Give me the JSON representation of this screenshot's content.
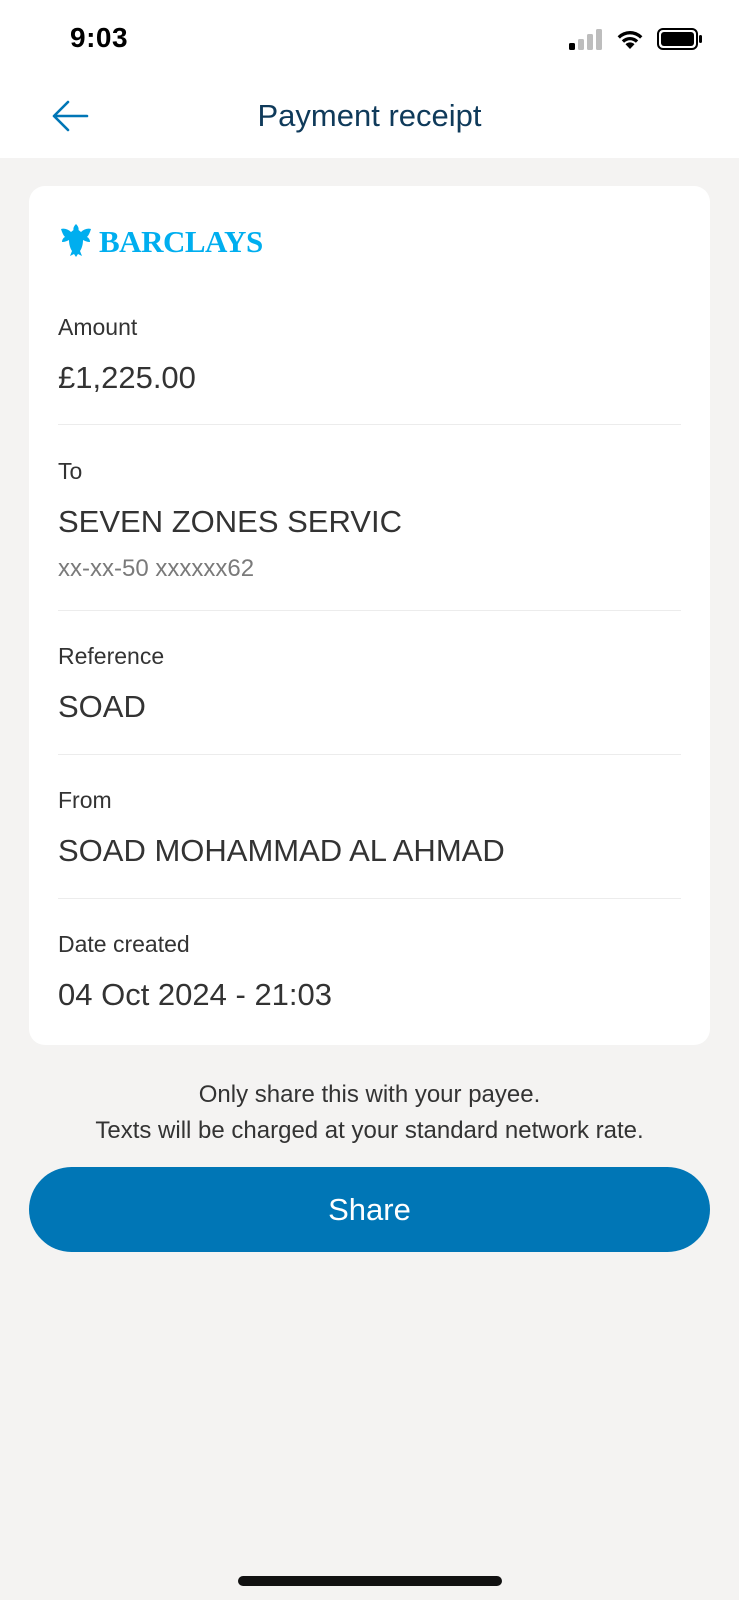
{
  "status_bar": {
    "time": "9:03",
    "icons": [
      "cellular-signal-icon",
      "wifi-icon",
      "battery-icon"
    ]
  },
  "header": {
    "title": "Payment receipt",
    "back_icon": "arrow-left-icon"
  },
  "receipt": {
    "brand": "BARCLAYS",
    "brand_color": "#00aeef",
    "amount": {
      "label": "Amount",
      "value": "£1,225.00"
    },
    "to": {
      "label": "To",
      "value": "SEVEN ZONES SERVIC",
      "account": "xx-xx-50 xxxxxx62"
    },
    "reference": {
      "label": "Reference",
      "value": "SOAD"
    },
    "from": {
      "label": "From",
      "value": "SOAD MOHAMMAD AL AHMAD"
    },
    "date_created": {
      "label": "Date created",
      "value": "04 Oct 2024 - 21:03"
    }
  },
  "notice": {
    "line1": "Only share this with your payee.",
    "line2": "Texts will be charged at your standard network rate."
  },
  "share_button": {
    "label": "Share",
    "color": "#0076b6"
  },
  "colors": {
    "title": "#0f3a5a",
    "background": "#f4f3f2",
    "accent": "#0076b6"
  }
}
